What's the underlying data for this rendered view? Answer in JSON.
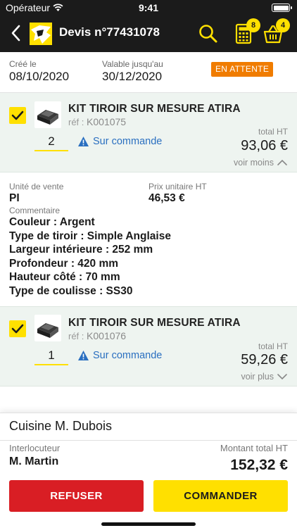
{
  "status_bar": {
    "carrier": "Opérateur",
    "time": "9:41"
  },
  "header": {
    "title": "Devis n°77431078",
    "calculator_badge": "8",
    "cart_badge": "4"
  },
  "quote_info": {
    "created_label": "Créé le",
    "created_value": "08/10/2020",
    "valid_label": "Valable jusqu'au",
    "valid_value": "30/12/2020",
    "status": "EN ATTENTE",
    "status_color": "#f07c00"
  },
  "items": [
    {
      "name": "KIT TIROIR SUR MESURE ATIRA",
      "ref_prefix": "réf :",
      "ref": "K001075",
      "quantity": "2",
      "availability": "Sur commande",
      "total_label": "total HT",
      "total": "93,06 €",
      "toggle": "voir moins",
      "details": {
        "unit_label": "Unité de vente",
        "unit_value": "PI",
        "price_label": "Prix unitaire HT",
        "price_value": "46,53 €",
        "comment_label": "Commentaire",
        "specs": [
          "Couleur : Argent",
          "Type de tiroir : Simple Anglaise",
          "Largeur intérieure : 252 mm",
          "Profondeur : 420 mm",
          "Hauteur côté : 70 mm",
          "Type de coulisse : SS30"
        ]
      }
    },
    {
      "name": "KIT TIROIR SUR MESURE ATIRA",
      "ref_prefix": "réf :",
      "ref": "K001076",
      "quantity": "1",
      "availability": "Sur commande",
      "total_label": "total HT",
      "total": "59,26 €",
      "toggle": "voir plus"
    }
  ],
  "summary": {
    "project": "Cuisine M. Dubois",
    "contact_label": "Interlocuteur",
    "contact_value": "M. Martin",
    "total_label": "Montant total HT",
    "total_value": "152,32 €"
  },
  "actions": {
    "refuse_label": "REFUSER",
    "refuse_color": "#d91e24",
    "order_label": "COMMANDER",
    "order_color": "#ffe000"
  },
  "icons": {
    "back": "chevron-left-icon",
    "search": "search-icon",
    "calculator": "calculator-icon",
    "cart": "basket-icon",
    "warning": "warning-icon",
    "checkbox": "check-icon"
  }
}
